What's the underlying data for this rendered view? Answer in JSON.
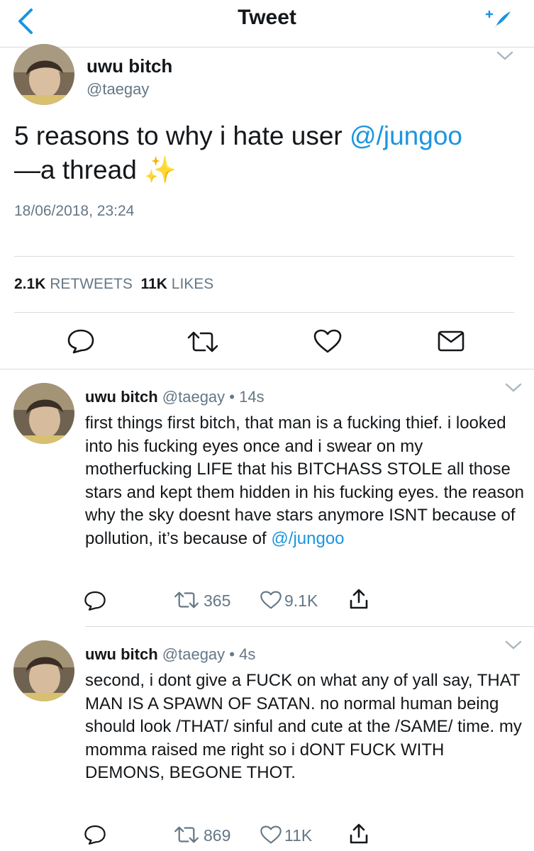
{
  "nav": {
    "title": "Tweet"
  },
  "main_tweet": {
    "name": "uwu bitch",
    "handle": "@taegay",
    "text_before": "5 reasons to why i hate user ",
    "mention": "@/jungoo",
    "text_line2": "—a thread ✨",
    "timestamp": "18/06/2018, 23:24",
    "retweets_count": "2.1K",
    "retweets_label": "RETWEETS",
    "likes_count": "11K",
    "likes_label": "LIKES"
  },
  "replies": [
    {
      "name": "uwu bitch",
      "handle": "@taegay",
      "time": "14s",
      "text": "first things first bitch, that man is a fucking thief. i looked into his fucking eyes once and i swear on my motherfucking LIFE that his BITCHASS STOLE all those stars and kept them hidden in his fucking eyes. the reason why the sky doesnt have stars anymore ISNT because of pollution, it’s because of ",
      "mention": "@/jungoo",
      "retweets": "365",
      "likes": "9.1K"
    },
    {
      "name": "uwu bitch",
      "handle": "@taegay",
      "time": "4s",
      "text": "second, i dont give a FUCK on what any of yall say, THAT MAN IS A SPAWN OF SATAN. no normal human being should look /THAT/ sinful and cute at the /SAME/ time. my momma raised me right so i dONT FUCK WITH DEMONS, BEGONE THOT.",
      "retweets": "869",
      "likes": "11K"
    }
  ],
  "colors": {
    "accent": "#1b95e0",
    "secondary_text": "#657786",
    "divider": "#d7dbdf",
    "action_icon": "#14171a"
  }
}
